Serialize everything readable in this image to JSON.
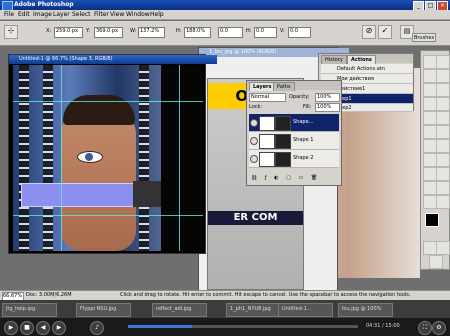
{
  "window": {
    "title": "Adobe Photoshop"
  },
  "menu": [
    "File",
    "Edit",
    "Image",
    "Layer",
    "Select",
    "Filter",
    "View",
    "Window",
    "Help"
  ],
  "options": {
    "x_label": "X:",
    "x_value": "259.0 px",
    "y_label": "Y:",
    "y_value": "369.0 px",
    "w_label": "W:",
    "w_value": "137.2%",
    "h_label": "H:",
    "h_value": "188.0%",
    "angle_value": "0.0",
    "h_skew_label": "H:",
    "h_skew_value": "0.0",
    "v_skew_label": "V:",
    "v_skew_value": "0.0",
    "brushes_label": "Brushes"
  },
  "doc1": {
    "title": "Untitled-1 @ 66.7% (Shape 3, RGB/8)"
  },
  "doc2": {
    "title": "1_lou_jpg @ 100% (RGB/8)",
    "banner": "OLTE",
    "cover_text": "ER COM"
  },
  "actions": {
    "tabs": [
      "History",
      "Actions"
    ],
    "items": [
      "Default Actions.atn",
      "Мои действия",
      "Действие1",
      "Step1",
      "Step2"
    ],
    "selected": 3
  },
  "layers": {
    "tabs": [
      "Layers",
      "Paths"
    ],
    "blend_mode": "Normal",
    "opacity_label": "Opacity:",
    "opacity_value": "100%",
    "lock_label": "Lock:",
    "fill_label": "Fill:",
    "fill_value": "100%",
    "items": [
      "Shape...",
      "Shape 1",
      "Shape 2"
    ]
  },
  "status": {
    "zoom": "66.67%",
    "doc": "Doc: 3.00M/6.26M",
    "hint": "Click and drag to rotate. Hit enter to commit. Hit escape to cancel. Use the spacebar to access the navigation tools."
  },
  "taskbar": [
    "jtg_help.ipg",
    "Flyppi NSU.jpg",
    "reflect_adl.jpg",
    "1_ph1_NYU8.jpg",
    "Untitled-1...",
    "lou.jpg @ 100%"
  ],
  "player": {
    "time": "04:31 / 15:00",
    "progress_pct": 28
  },
  "colors": {
    "title_blue": "#0a2f84",
    "selection_navy": "#10246a",
    "shape_purple": "#8d8ff0"
  },
  "icons": [
    "commit-check-icon",
    "cancel-icon",
    "close-icon",
    "eye-icon",
    "play-icon",
    "stop-icon"
  ]
}
